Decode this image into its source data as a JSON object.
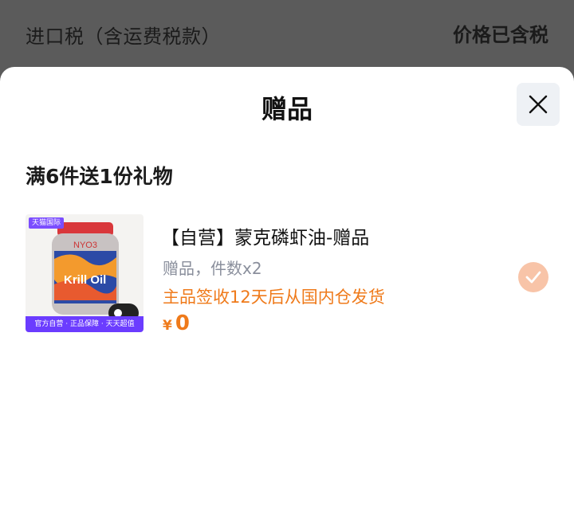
{
  "background": {
    "tax_label": "进口税（含运费税款）",
    "tax_value": "价格已含税"
  },
  "sheet": {
    "title": "赠品",
    "close_icon": "close-icon",
    "promo_title": "满6件送1份礼物",
    "product": {
      "thumb_badge": "天猫国际",
      "thumb_footer": "官方自营 · 正品保障 · 天天超值",
      "thumb_label": "Krill Oil",
      "name": "【自营】蒙克磷虾油-赠品",
      "qty": "赠品，件数x2",
      "ship_note": "主品签收12天后从国内仓发货",
      "currency": "¥",
      "price": "0",
      "selected": true
    }
  },
  "colors": {
    "accent": "#ef7a1a",
    "check": "#f8c4a8",
    "overlay": "#5b5b5b"
  }
}
